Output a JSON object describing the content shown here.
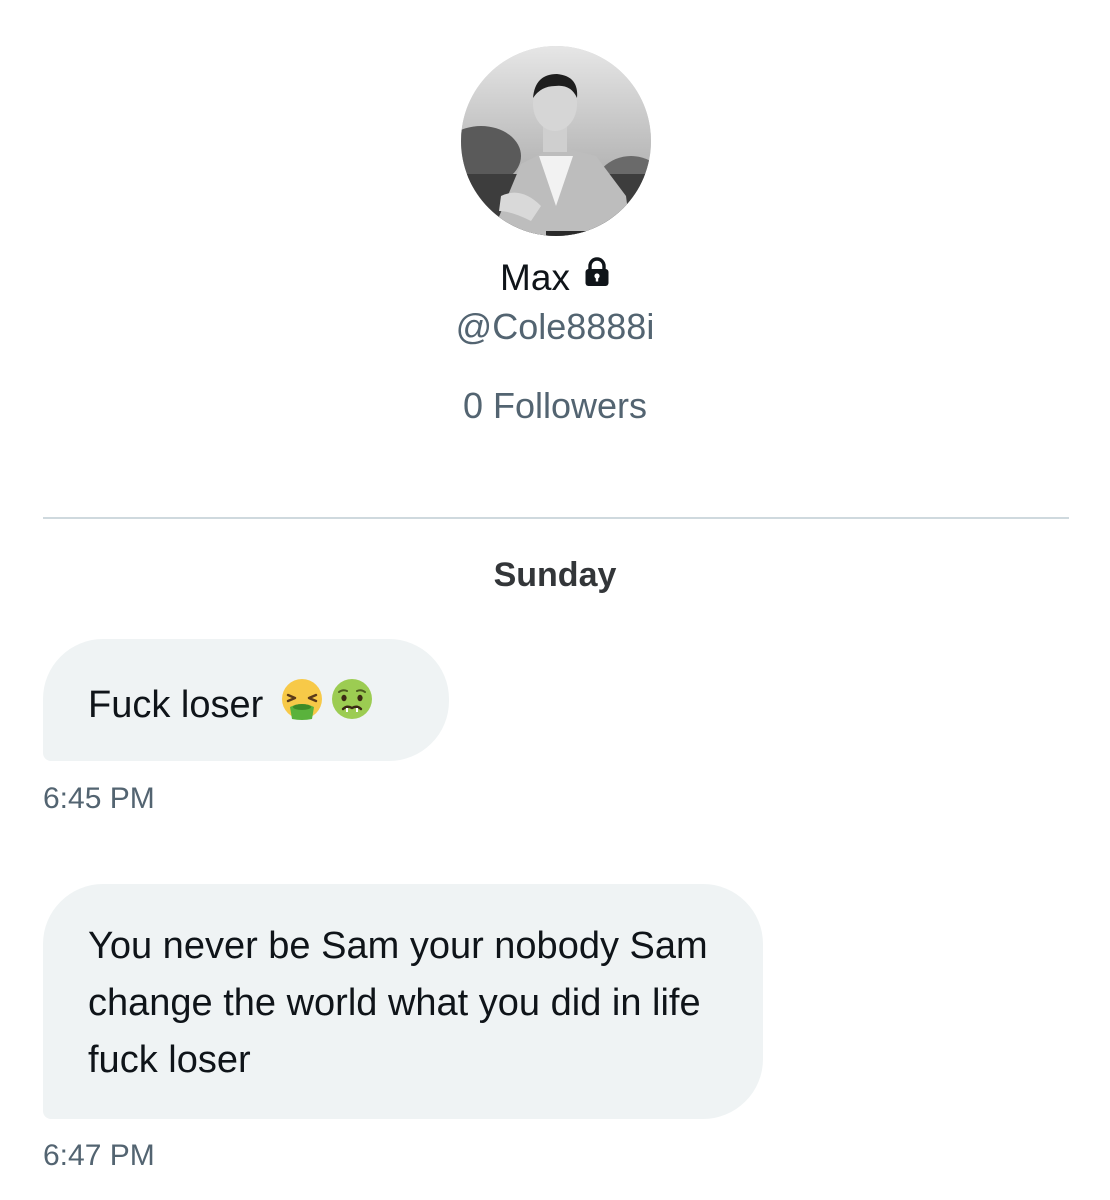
{
  "profile": {
    "display_name": "Max",
    "handle": "@Cole8888i",
    "followers": "0 Followers",
    "protected_icon": "lock-icon",
    "avatar_description": "black-and-white portrait photo"
  },
  "conversation": {
    "day_label": "Sunday",
    "messages": [
      {
        "text": "Fuck loser",
        "emojis": [
          "vomiting-face-emoji",
          "nauseated-face-emoji"
        ],
        "time": "6:45 PM"
      },
      {
        "text": "You never be Sam your nobody Sam change the world what you did in life fuck loser",
        "time": "6:47 PM"
      }
    ]
  },
  "colors": {
    "primary_text": "#0f1419",
    "secondary_text": "#536471",
    "bubble_bg": "#eff3f4",
    "divider": "#cfd9de"
  }
}
